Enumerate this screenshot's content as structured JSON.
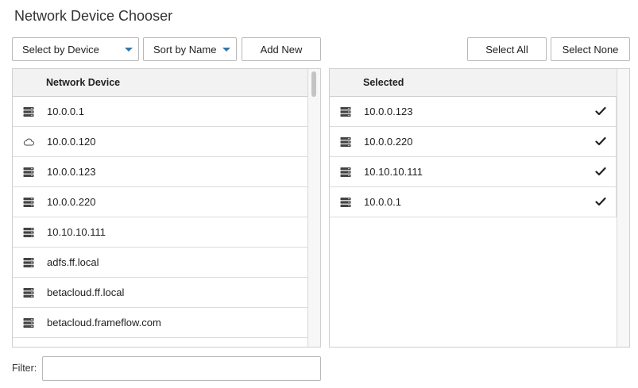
{
  "title": "Network Device Chooser",
  "toolbar": {
    "select_by": "Select by Device",
    "sort_by": "Sort by Name",
    "add_new": "Add New",
    "select_all": "Select All",
    "select_none": "Select None"
  },
  "left_panel": {
    "header": "Network Device",
    "rows": [
      {
        "label": "10.0.0.1",
        "icon": "server-icon"
      },
      {
        "label": "10.0.0.120",
        "icon": "cloud-icon"
      },
      {
        "label": "10.0.0.123",
        "icon": "server-icon"
      },
      {
        "label": "10.0.0.220",
        "icon": "server-icon"
      },
      {
        "label": "10.10.10.111",
        "icon": "server-icon"
      },
      {
        "label": "adfs.ff.local",
        "icon": "server-icon"
      },
      {
        "label": "betacloud.ff.local",
        "icon": "server-icon"
      },
      {
        "label": "betacloud.frameflow.com",
        "icon": "server-icon"
      }
    ]
  },
  "right_panel": {
    "header": "Selected",
    "rows": [
      {
        "label": "10.0.0.123",
        "icon": "server-icon",
        "checked": true
      },
      {
        "label": "10.0.0.220",
        "icon": "server-icon",
        "checked": true
      },
      {
        "label": "10.10.10.111",
        "icon": "server-icon",
        "checked": true
      },
      {
        "label": "10.0.0.1",
        "icon": "server-icon",
        "checked": true
      }
    ]
  },
  "filter": {
    "label": "Filter:",
    "value": "",
    "placeholder": ""
  },
  "colors": {
    "caret": "#2a7ab5",
    "header_bg": "#f2f2f2",
    "border": "#cfcfcf"
  }
}
